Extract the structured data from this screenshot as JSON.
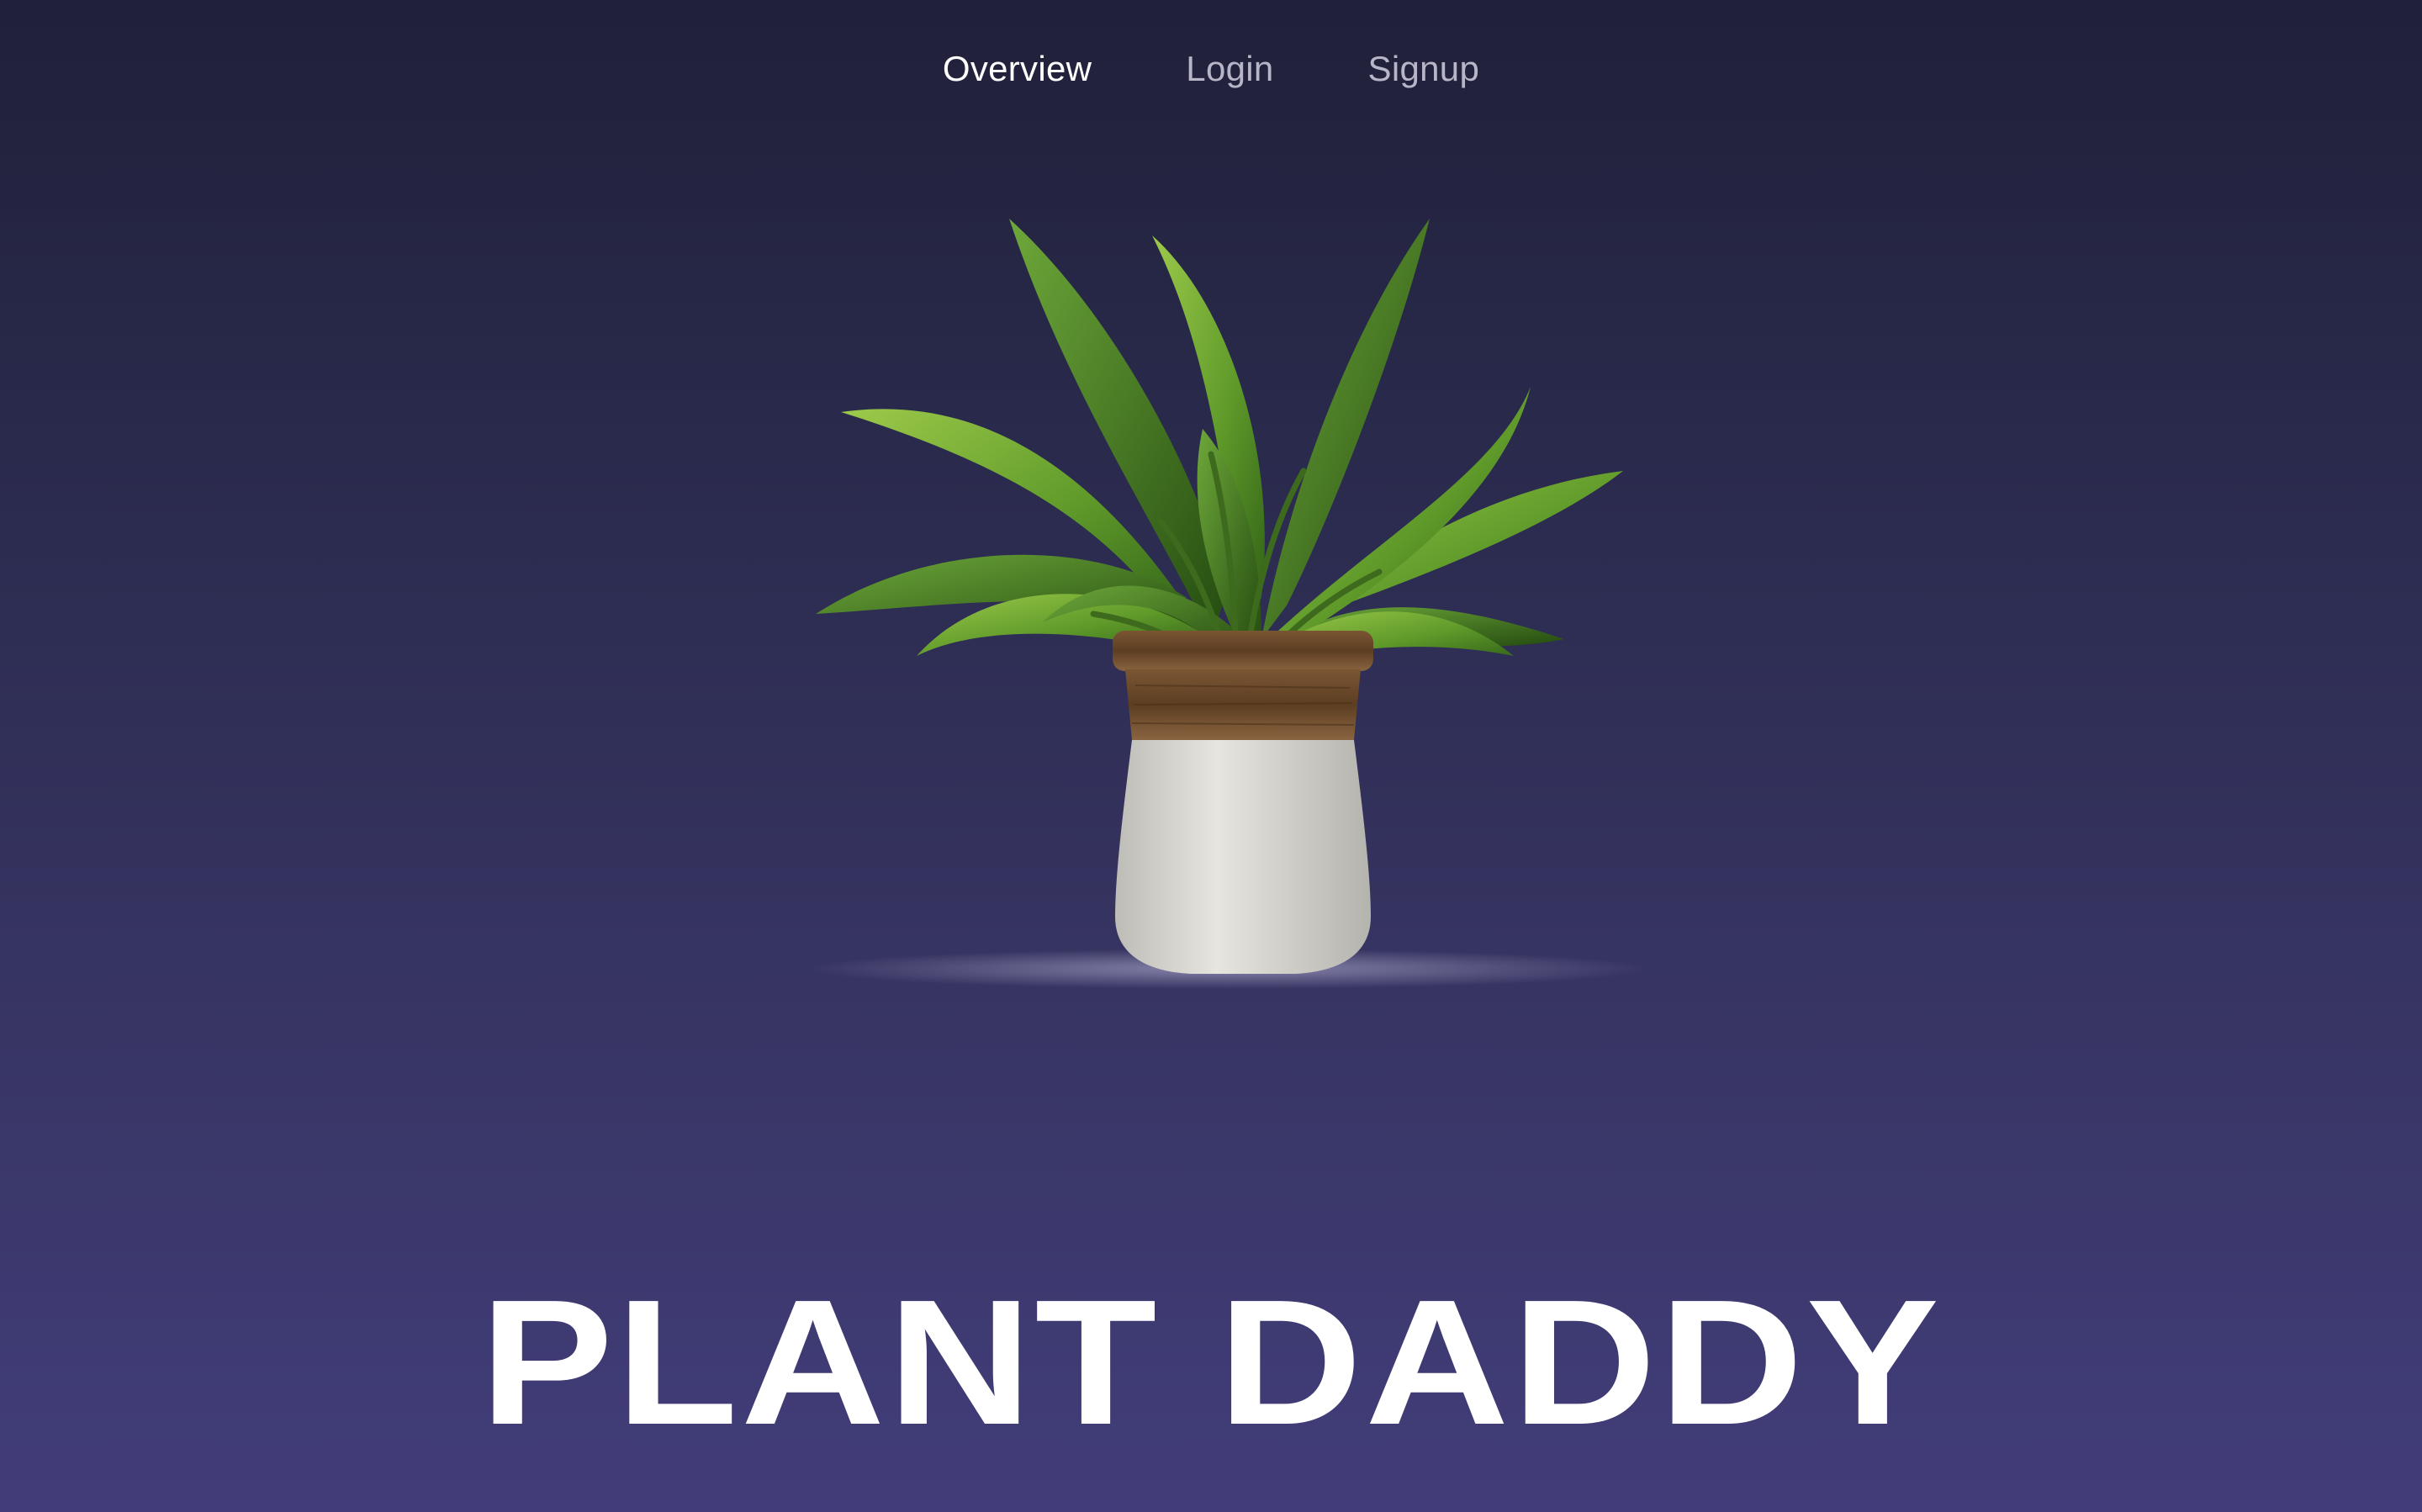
{
  "nav": {
    "items": [
      {
        "label": "Overview",
        "active": true
      },
      {
        "label": "Login",
        "active": false
      },
      {
        "label": "Signup",
        "active": false
      }
    ]
  },
  "hero": {
    "image_icon": "potted-plant-icon",
    "title": "PLANT DADDY"
  },
  "colors": {
    "background_top": "#20203a",
    "background_bottom": "#423d7a",
    "nav_active": "#ffffff",
    "nav_inactive": "#b7b6c9",
    "title": "#ffffff"
  }
}
